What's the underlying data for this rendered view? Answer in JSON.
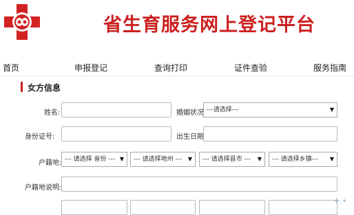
{
  "header": {
    "title": "省生育服务网上登记平台",
    "logo_icon": "red-cross-logo-icon"
  },
  "nav": {
    "items": [
      {
        "label": "首页"
      },
      {
        "label": "申报登记"
      },
      {
        "label": "查询打印"
      },
      {
        "label": "证件查验"
      },
      {
        "label": "服务指南"
      }
    ]
  },
  "section": {
    "title": "女方信息",
    "accent": "#c81e1e"
  },
  "form": {
    "name_label": "姓名:",
    "marital_label": "婚姻状况:",
    "marital_value": "---请选择---",
    "id_label": "身份证号:",
    "birth_label": "出生日期:",
    "hukou_label": "户籍地:",
    "province_value": "--- 请选择 省份 ---",
    "city_value": "--- 请选择地州 ---",
    "county_value": "--- 请选择县市 ---",
    "town_value": "--- 请选择乡镇---",
    "hukou_desc_label": "户籍地说明:"
  },
  "colors": {
    "brand_red": "#cc1f1f"
  }
}
